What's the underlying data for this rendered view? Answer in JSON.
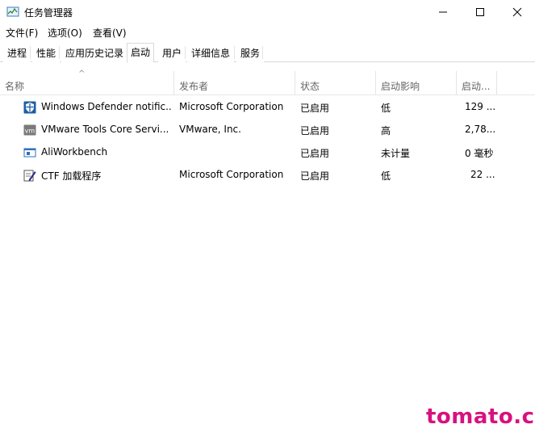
{
  "window": {
    "title": "任务管理器"
  },
  "menu": [
    "文件(F)",
    "选项(O)",
    "查看(V)"
  ],
  "tabs": [
    "进程",
    "性能",
    "应用历史记录",
    "启动",
    "用户",
    "详细信息",
    "服务"
  ],
  "active_tab": "启动",
  "columns": [
    "名称",
    "发布者",
    "状态",
    "启动影响",
    "启动..."
  ],
  "rows": [
    {
      "name": "Windows Defender notific...",
      "publisher": "Microsoft Corporation",
      "status": "已启用",
      "impact": "低",
      "time": "129 ...",
      "icon": "shield-icon"
    },
    {
      "name": "VMware Tools Core Servi...",
      "publisher": "VMware, Inc.",
      "status": "已启用",
      "impact": "高",
      "time": "2,78...",
      "icon": "vmware-icon"
    },
    {
      "name": "AliWorkbench",
      "publisher": "",
      "status": "已启用",
      "impact": "未计量",
      "time": "0 毫秒",
      "icon": "app-window-icon"
    },
    {
      "name": "CTF 加载程序",
      "publisher": "Microsoft Corporation",
      "status": "已启用",
      "impact": "低",
      "time": "22 ...",
      "icon": "pen-icon"
    }
  ],
  "watermark": "tomato.cm"
}
